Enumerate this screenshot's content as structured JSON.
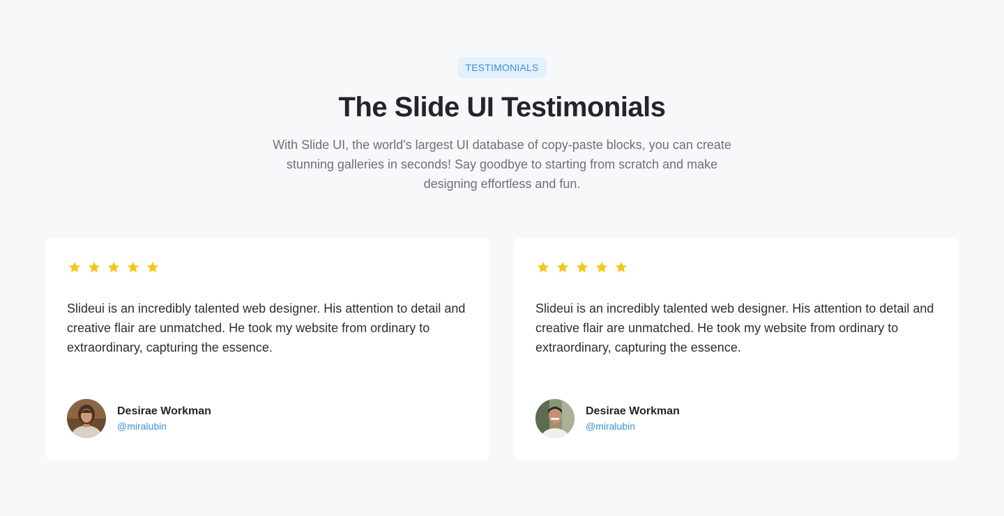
{
  "section": {
    "badge": "TESTIMONIALS",
    "title": "The Slide UI Testimonials",
    "subtitle": "With Slide UI, the world's largest UI database of copy-paste blocks, you can create stunning galleries in seconds! Say goodbye to starting from scratch and make designing effortless and fun."
  },
  "colors": {
    "accent": "#3d8fd6",
    "badge_bg": "#e3f1fd",
    "star": "#f5c518",
    "background": "#f7f8fa",
    "card": "#ffffff"
  },
  "testimonials": [
    {
      "rating": 5,
      "quote": "Slideui is an incredibly talented web designer. His attention to detail and creative flair are unmatched. He took my website from ordinary to extraordinary, capturing the essence.",
      "name": "Desirae Workman",
      "handle": "@miralubin",
      "avatar": "woman-portrait-avatar"
    },
    {
      "rating": 5,
      "quote": "Slideui is an incredibly talented web designer. His attention to detail and creative flair are unmatched. He took my website from ordinary to extraordinary, capturing the essence.",
      "name": "Desirae Workman",
      "handle": "@miralubin",
      "avatar": "man-portrait-avatar"
    }
  ]
}
